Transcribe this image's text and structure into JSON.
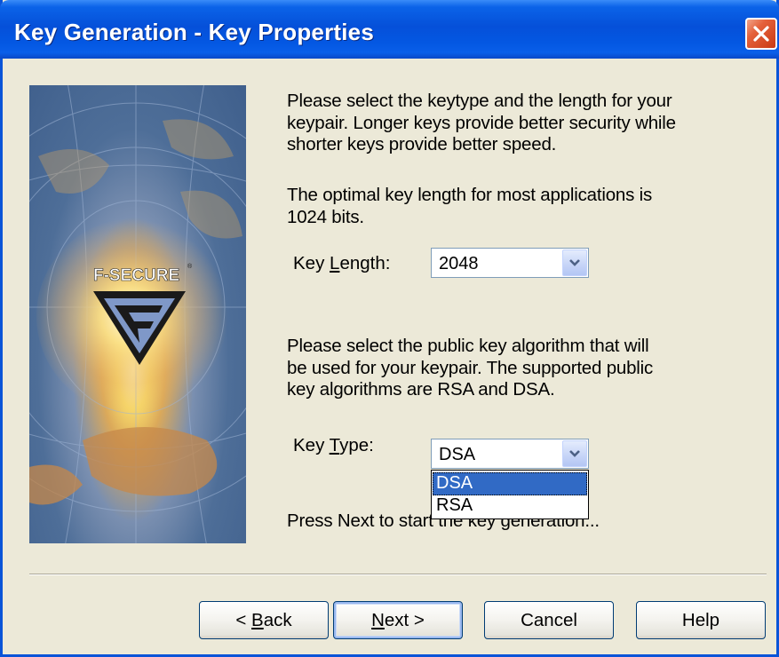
{
  "window": {
    "title": "Key Generation - Key Properties"
  },
  "banner": {
    "logo_text": "F-SECURE",
    "registered_mark": "®"
  },
  "intro": {
    "line1": "Please select the keytype and the length for your",
    "line2": "keypair. Longer keys provide better security while",
    "line3": "shorter keys provide better speed.",
    "optimal1": "The optimal key length for most applications is",
    "optimal2": "1024 bits."
  },
  "key_length": {
    "label_pre": "Key ",
    "label_accel": "L",
    "label_post": "ength:",
    "value": "2048"
  },
  "algorithm": {
    "line1": "Please select the public key algorithm that will",
    "line2": "be used for your keypair. The supported public",
    "line3": "key algorithms are RSA and DSA."
  },
  "key_type": {
    "label_pre": "Key ",
    "label_accel": "T",
    "label_post": "ype:",
    "value": "DSA",
    "options": [
      "DSA",
      "RSA"
    ],
    "selected_index": 0
  },
  "footer_note": {
    "text": "Press Next to start the key generation..."
  },
  "buttons": {
    "back_pre": "< ",
    "back_accel": "B",
    "back_post": "ack",
    "next_accel": "N",
    "next_post": "ext >",
    "cancel": "Cancel",
    "help": "Help"
  },
  "colors": {
    "titlebar": "#0550d9",
    "dialog_bg": "#ece9d8",
    "selection": "#316ac5",
    "close_button": "#e4603a"
  }
}
